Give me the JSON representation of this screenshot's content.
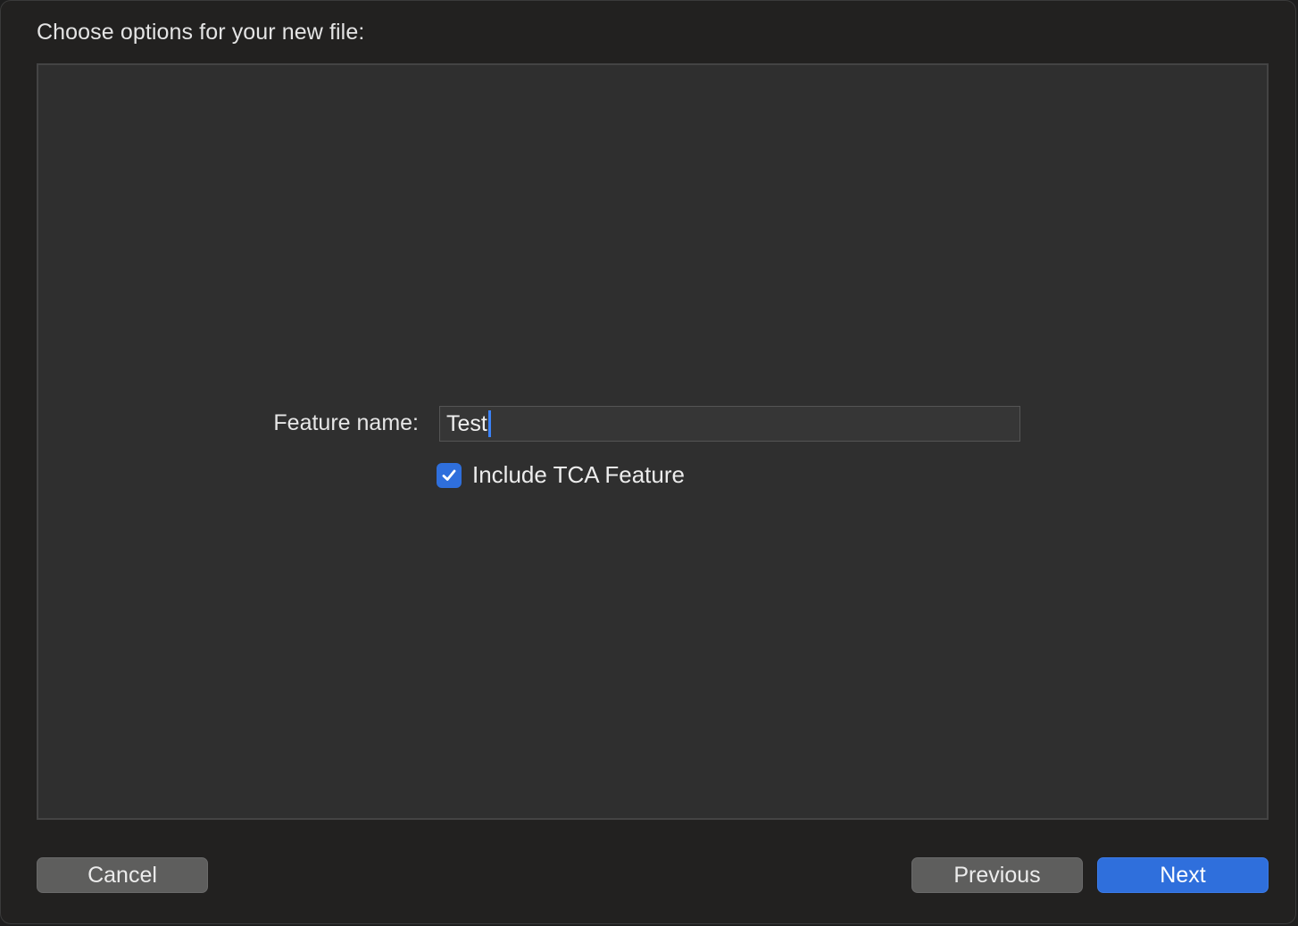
{
  "dialog": {
    "title": "Choose options for your new file:"
  },
  "form": {
    "feature_name_label": "Feature name:",
    "feature_name_value": "Test",
    "include_tca_label": "Include TCA Feature",
    "include_tca_checked": true
  },
  "buttons": {
    "cancel": "Cancel",
    "previous": "Previous",
    "next": "Next"
  },
  "colors": {
    "accent": "#2f6fdc",
    "panel": "#2f2f2f",
    "background": "#222120"
  },
  "icons": {
    "checkbox": "checkmark-icon"
  }
}
